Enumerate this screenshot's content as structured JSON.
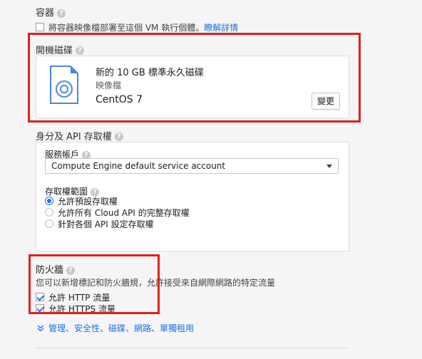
{
  "container": {
    "title": "容器",
    "checkbox_label": "將容器映像檔部署至這個 VM 執行個體。",
    "learn_more": "瞭解詳情"
  },
  "boot_disk": {
    "title": "開機磁碟",
    "disk_desc": "新的 10 GB 標準永久磁碟",
    "image_label": "映像檔",
    "image_name": "CentOS 7",
    "change_button": "變更"
  },
  "identity": {
    "title": "身分及 API 存取權",
    "service_account_label": "服務帳戶",
    "service_account_value": "Compute Engine default service account",
    "scopes_label": "存取權範圍",
    "scopes": [
      {
        "label": "允許預設存取權",
        "selected": true
      },
      {
        "label": "允許所有 Cloud API 的完整存取權",
        "selected": false
      },
      {
        "label": "針對各個 API 設定存取權",
        "selected": false
      }
    ]
  },
  "firewall": {
    "title": "防火牆",
    "description": "您可以新增標記和防火牆規，允許接受來自網際網路的特定流量",
    "http_label": "允許 HTTP 流量",
    "https_label": "允許 HTTPS 流量"
  },
  "more_link": "管理、安全性、磁碟、網路、單獨租用",
  "colors": {
    "accent": "#1a73e8",
    "highlight": "#e0201f"
  }
}
